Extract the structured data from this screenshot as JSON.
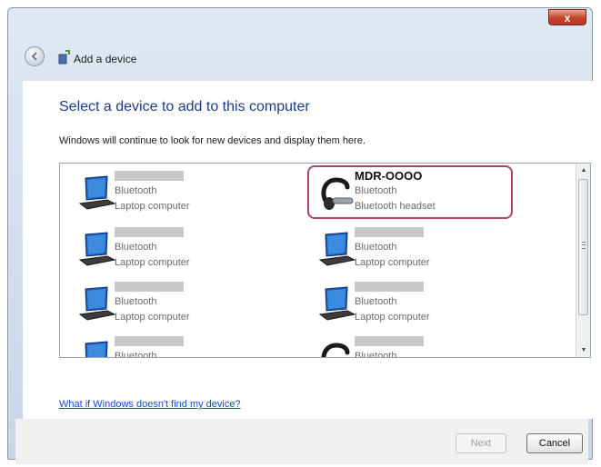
{
  "window": {
    "close_label": "x"
  },
  "navbar": {
    "title": "Add a device"
  },
  "heading": "Select a device to add to this computer",
  "subtext": "Windows will continue to look for new devices and display them here.",
  "devices": [
    {
      "icon": "laptop-icon",
      "name": "",
      "line1": "Bluetooth",
      "line2": "Laptop computer"
    },
    {
      "icon": "headset-icon",
      "name": "MDR-OOOO",
      "line1": "Bluetooth",
      "line2": "Bluetooth headset",
      "highlighted": true
    },
    {
      "icon": "laptop-icon",
      "name": "",
      "line1": "Bluetooth",
      "line2": "Laptop computer"
    },
    {
      "icon": "laptop-icon",
      "name": "",
      "line1": "Bluetooth",
      "line2": "Laptop computer"
    },
    {
      "icon": "laptop-icon",
      "name": "",
      "line1": "Bluetooth",
      "line2": "Laptop computer"
    },
    {
      "icon": "laptop-icon",
      "name": "",
      "line1": "Bluetooth",
      "line2": "Laptop computer"
    },
    {
      "icon": "laptop-icon",
      "name": "",
      "line1": "Bluetooth",
      "line2": ""
    },
    {
      "icon": "headset-icon",
      "name": "",
      "line1": "Bluetooth",
      "line2": ""
    }
  ],
  "help_link": "What if Windows doesn't find my device?",
  "buttons": {
    "next": "Next",
    "cancel": "Cancel"
  },
  "colors": {
    "heading": "#1e3a8a",
    "highlight": "#b3406f",
    "link": "#1a49c9"
  }
}
